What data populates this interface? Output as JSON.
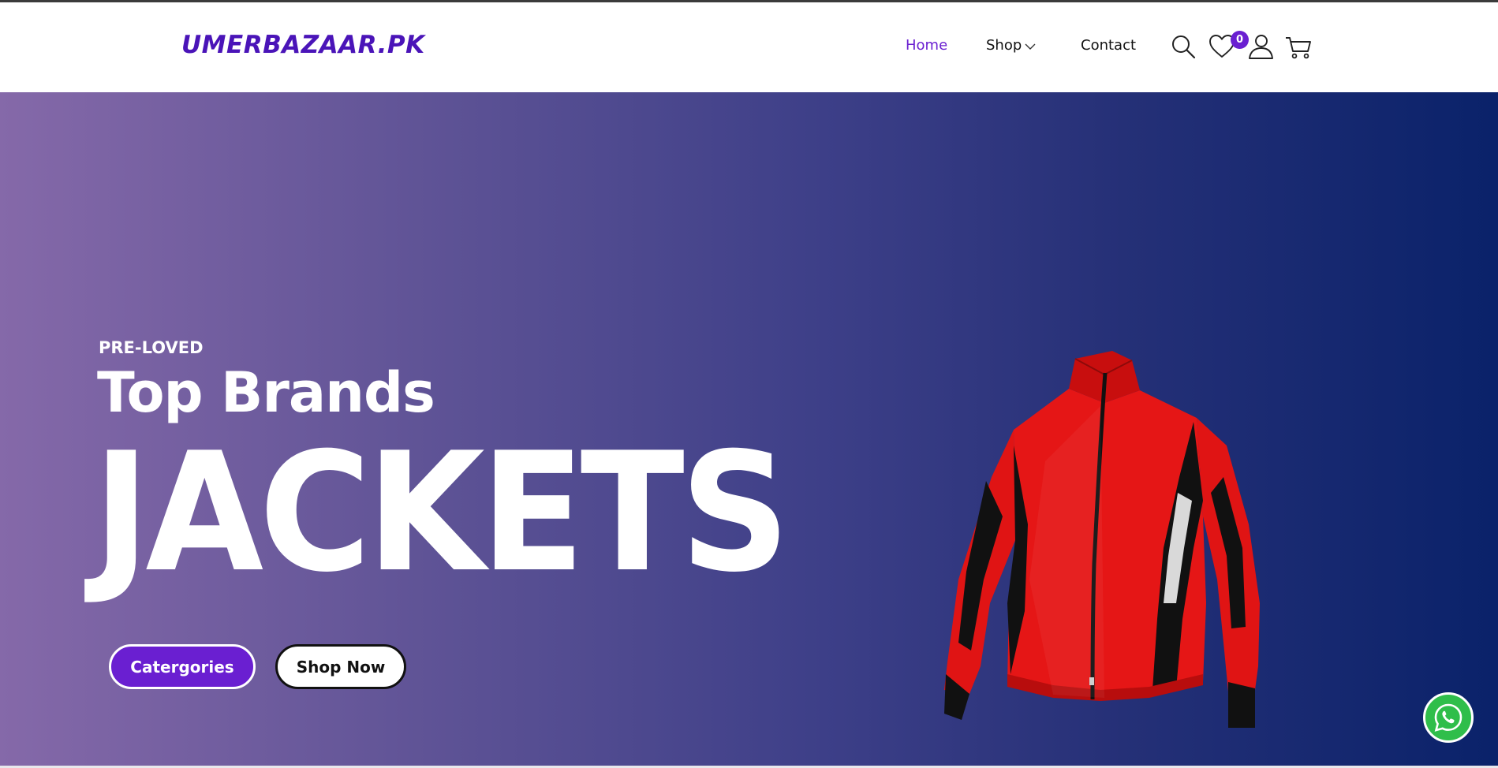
{
  "header": {
    "logo": "UMERBAZAAR.PK",
    "nav": [
      {
        "label": "Home",
        "active": true
      },
      {
        "label": "Shop",
        "has_dropdown": true
      },
      {
        "label": "Contact"
      }
    ],
    "icons": [
      "search-icon",
      "heart-icon",
      "user-icon",
      "cart-icon"
    ],
    "wishlist_count": "0"
  },
  "hero": {
    "kicker": "PRE-LOVED",
    "headline": "Top Brands",
    "big_word": "JACKETS",
    "buttons": {
      "categories": "Catergories",
      "shop_now": "Shop Now"
    },
    "image": "red-black-jacket"
  },
  "floating": {
    "icon": "whatsapp-icon"
  },
  "colors": {
    "brand_purple": "#6a1fd1",
    "logo_purple": "#4a14b8",
    "hero_gradient_start": "#8569a9",
    "hero_gradient_end": "#0a226a",
    "whatsapp_green": "#2fbe4a"
  }
}
